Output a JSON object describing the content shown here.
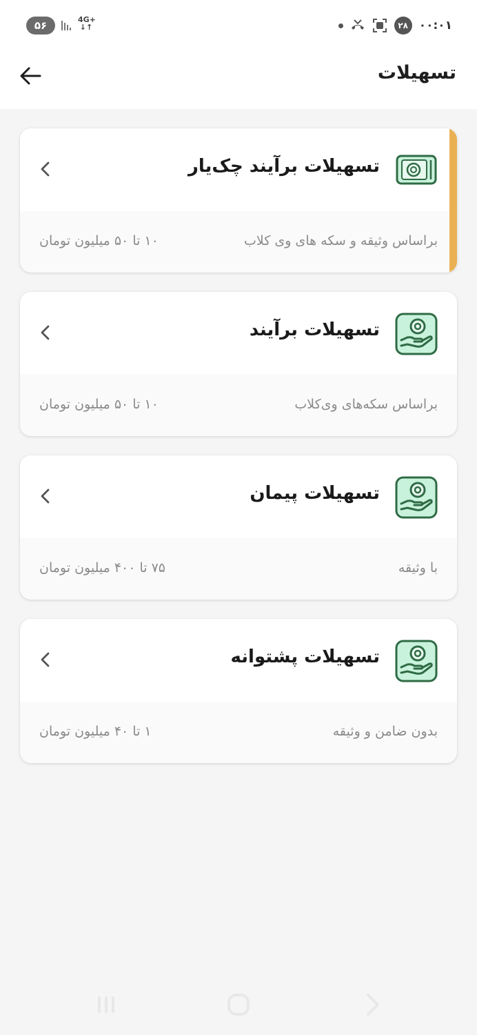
{
  "status_bar": {
    "battery": "۵۶",
    "network": "4G+",
    "notification_count": "۲۸",
    "time": "۰۰:۰۱"
  },
  "header": {
    "title": "تسهیلات",
    "back_icon": "arrow-left-icon"
  },
  "cards": [
    {
      "title": "تسهیلات برآیند چک‌یار",
      "description": "براساس وثیقه و سکه های وی کلاب",
      "range": "۱۰ تا ۵۰ میلیون تومان",
      "icon": "cheque-icon",
      "highlighted": true
    },
    {
      "title": "تسهیلات برآیند",
      "description": "براساس سکه‌های وی‌کلاب",
      "range": "۱۰ تا ۵۰ میلیون تومان",
      "icon": "hand-coin-icon"
    },
    {
      "title": "تسهیلات پیمان",
      "description": "با وثیقه",
      "range": "۷۵ تا ۴۰۰ میلیون تومان",
      "icon": "hand-coin-icon"
    },
    {
      "title": "تسهیلات پشتوانه",
      "description": "بدون ضامن و وثیقه",
      "range": "۱ تا ۴۰ میلیون تومان",
      "icon": "hand-coin-icon"
    }
  ],
  "colors": {
    "accent": "#eab154",
    "icon_green": "#2f6b45",
    "icon_fill": "#c9f2dc"
  }
}
